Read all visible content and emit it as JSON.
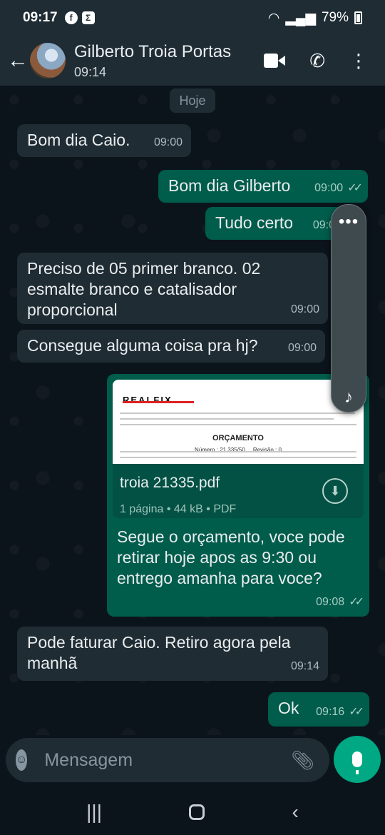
{
  "status_bar": {
    "time": "09:17",
    "battery": "79%",
    "left_icons": [
      "facebook-icon",
      "sigma-app-icon"
    ]
  },
  "header": {
    "contact_name": "Gilberto Troia Portas",
    "subtitle": "09:14"
  },
  "chat": {
    "date_chip": "Hoje",
    "messages": [
      {
        "direction": "in",
        "text": "Bom dia Caio.",
        "time": "09:00"
      },
      {
        "direction": "out",
        "text": "Bom dia Gilberto",
        "time": "09:00",
        "ticks": "read"
      },
      {
        "direction": "out",
        "text": "Tudo certo",
        "time": "09:0",
        "ticks": "read"
      },
      {
        "direction": "in",
        "text": "Preciso de 05 primer branco.  02 esmalte branco e catalisador proporcional",
        "time": "09:00"
      },
      {
        "direction": "in",
        "text": "Consegue alguma coisa pra hj?",
        "time": "09:00"
      },
      {
        "direction": "in",
        "text": "Pode faturar Caio. Retiro agora pela manhã",
        "time": "09:14"
      },
      {
        "direction": "out",
        "text": "Ok",
        "time": "09:16",
        "ticks": "read"
      }
    ],
    "document": {
      "preview_brand": "REALFIX",
      "preview_title": "ORÇAMENTO",
      "preview_number_label": "Número :",
      "preview_number": "21.335/50",
      "preview_revision_label": "Revisão :",
      "preview_revision": "0",
      "file_name": "troia 21335.pdf",
      "file_pages": "1 página",
      "file_size": "44 kB",
      "file_type": "PDF",
      "caption": "Segue o orçamento, voce pode retirar hoje apos as 9:30 ou entrego amanha para voce?",
      "time": "09:08"
    }
  },
  "input": {
    "placeholder": "Mensagem"
  },
  "colors": {
    "outgoing_bubble": "#005c4b",
    "incoming_bubble": "#202c33",
    "accent": "#00a884",
    "background": "#0b141a"
  }
}
